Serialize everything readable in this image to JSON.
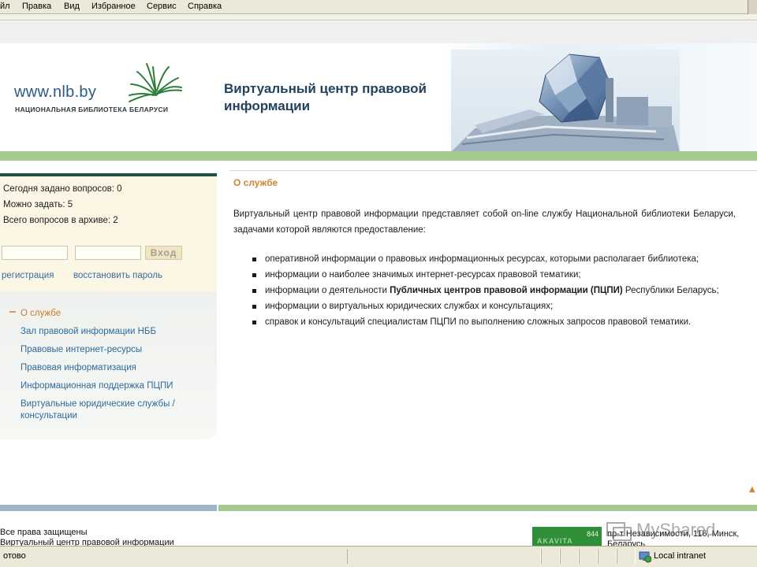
{
  "menu": {
    "items": [
      "йл",
      "Правка",
      "Вид",
      "Избранное",
      "Сервис",
      "Справка"
    ]
  },
  "header": {
    "logo_url_text": "www.nlb.by",
    "logo_subtitle": "НАЦИОНАЛЬНАЯ БИБЛИОТЕКА БЕЛАРУСИ",
    "title_line1": "Виртуальный центр правовой",
    "title_line2": "информации"
  },
  "stats": {
    "asked_today": "Сегодня задано вопросов: 0",
    "can_ask": "Можно задать: 5",
    "total_archive": "Всего вопросов в архиве: 2"
  },
  "login": {
    "login_value": "",
    "password_value": "",
    "button_label": "Вход",
    "register_link": "регистрация",
    "restore_link": "восстановить пароль"
  },
  "nav": {
    "items": [
      {
        "label": "О службе",
        "active": true
      },
      {
        "label": "Зал правовой информации НББ",
        "active": false
      },
      {
        "label": "Правовые интернет-ресурсы",
        "active": false
      },
      {
        "label": "Правовая информатизация",
        "active": false
      },
      {
        "label": "Информационная поддержка ПЦПИ",
        "active": false
      },
      {
        "label": "Виртуальные юридические службы / консультации",
        "active": false
      }
    ]
  },
  "content": {
    "section_title": "О службе",
    "intro": "Виртуальный центр правовой информации представляет собой on-line службу Национальной библиотеки Беларуси, задачами которой являются предоставление:",
    "bullets": {
      "b1": "оперативной информации о правовых информационных ресурсах, которыми располагает библиотека;",
      "b2": "информации о наиболее значимых интернет-ресурсах правовой тематики;",
      "b3_before": "информации о деятельности ",
      "b3_bold": "Публичных центров правовой информации (ПЦПИ)",
      "b3_after": " Республики Беларусь;",
      "b4": "информации о виртуальных юридических службах и консультациях;",
      "b5": "справок и консультаций специалистам ПЦПИ по выполнению сложных запросов правовой тематики."
    }
  },
  "footer": {
    "rights": "Все права защищены",
    "site_name": "Виртуальный центр правовой информации",
    "counter_value": "844",
    "counter_brand": "AKAVITA",
    "address_line1": "пр-т Независимости, 116, Минск,",
    "address_line2": "Беларусь",
    "watermark": "MyShared"
  },
  "statusbar": {
    "status": "отово",
    "zone": "Local intranet"
  },
  "colors": {
    "header_title": "#24425c",
    "link": "#2e6a9b",
    "accent_orange": "#d18235",
    "green_strip": "#a6c98f",
    "dark_green_bar": "#1f4f45"
  }
}
